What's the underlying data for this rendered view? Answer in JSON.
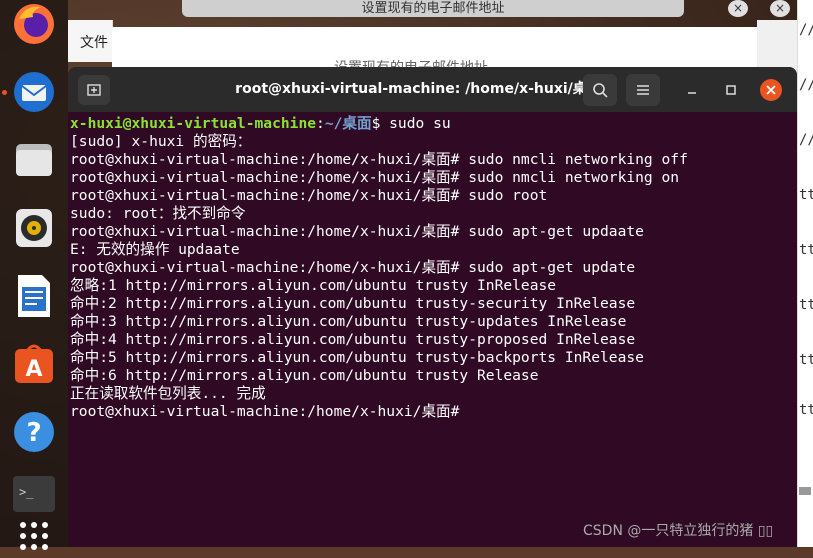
{
  "background_dialog": {
    "title": "设置现有的电子邮件地址",
    "body_text": "设置现有的电子邮件地址",
    "file_menu": "文件",
    "close_symbol": "×"
  },
  "right_document": {
    "lines": [
      "//",
      "//",
      "//",
      "tt",
      "tt",
      "tt",
      "tt",
      "tt"
    ]
  },
  "dock": {
    "items": [
      {
        "name": "firefox-icon"
      },
      {
        "name": "thunderbird-icon"
      },
      {
        "name": "files-icon"
      },
      {
        "name": "rhythmbox-icon"
      },
      {
        "name": "libreoffice-writer-icon"
      },
      {
        "name": "software-center-icon"
      },
      {
        "name": "help-icon"
      },
      {
        "name": "terminal-icon"
      },
      {
        "name": "show-applications-icon"
      }
    ]
  },
  "terminal": {
    "title": "root@xhuxi-virtual-machine: /home/x-huxi/桌面",
    "first_prompt_user": "x-huxi@xhuxi-virtual-machine",
    "first_prompt_sep": ":",
    "first_prompt_path": "~/桌面",
    "first_prompt_cmd": "$ sudo su",
    "lines": [
      "[sudo] x-huxi 的密码：",
      "root@xhuxi-virtual-machine:/home/x-huxi/桌面# sudo nmcli networking off",
      "root@xhuxi-virtual-machine:/home/x-huxi/桌面# sudo nmcli networking on",
      "root@xhuxi-virtual-machine:/home/x-huxi/桌面# sudo root",
      "sudo: root：找不到命令",
      "root@xhuxi-virtual-machine:/home/x-huxi/桌面# sudo apt-get updaate",
      "E: 无效的操作 updaate",
      "root@xhuxi-virtual-machine:/home/x-huxi/桌面# sudo apt-get update",
      "忽略:1 http://mirrors.aliyun.com/ubuntu trusty InRelease",
      "命中:2 http://mirrors.aliyun.com/ubuntu trusty-security InRelease",
      "命中:3 http://mirrors.aliyun.com/ubuntu trusty-updates InRelease",
      "命中:4 http://mirrors.aliyun.com/ubuntu trusty-proposed InRelease",
      "命中:5 http://mirrors.aliyun.com/ubuntu trusty-backports InRelease",
      "命中:6 http://mirrors.aliyun.com/ubuntu trusty Release",
      "正在读取软件包列表... 完成",
      "root@xhuxi-virtual-machine:/home/x-huxi/桌面# "
    ]
  },
  "watermark": "CSDN @一只特立独行的猪 ▯▯",
  "colors": {
    "terminal_bg": "#300a24",
    "titlebar_bg": "#2b2b2b",
    "close_accent": "#e95420",
    "prompt_user": "#8ae234",
    "prompt_path": "#729fcf"
  }
}
